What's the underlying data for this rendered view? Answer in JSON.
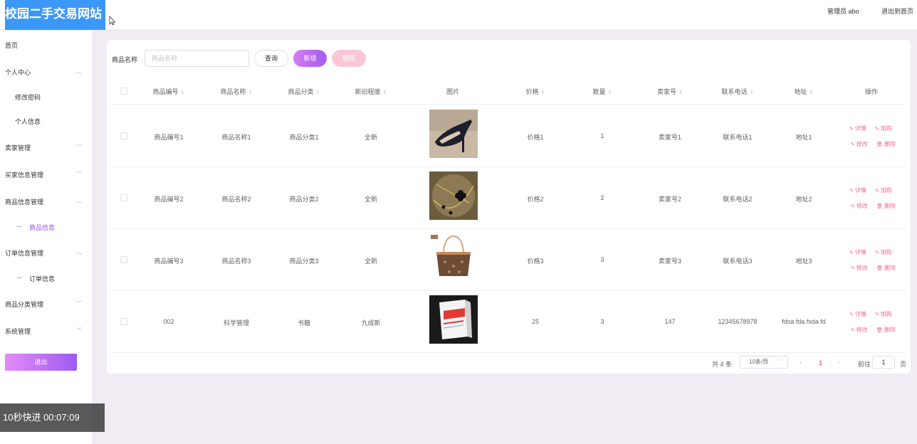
{
  "header": {
    "logo": "校园二手交易网站",
    "admin": "管理员 abo",
    "exit_home": "退出到首页"
  },
  "sidebar": {
    "home": "首页",
    "personal_center": "个人中心",
    "change_password": "修改密码",
    "personal_info": "个人信息",
    "seller_mgmt": "卖家管理",
    "buyer_mgmt": "买家信息管理",
    "product_mgmt": "商品信息管理",
    "product_info": "商品信息",
    "order_mgmt": "订单信息管理",
    "order_info": "订单信息",
    "category_mgmt": "商品分类管理",
    "system_mgmt": "系统管理",
    "logout": "退出"
  },
  "overlay": {
    "timer": "10秒快进   00:07:09"
  },
  "search": {
    "label": "商品名称",
    "placeholder": "商品名称",
    "query": "查询",
    "add": "新增",
    "delete": "删除"
  },
  "table": {
    "columns": [
      "商品编号",
      "商品名称",
      "商品分类",
      "新旧程度",
      "图片",
      "价格",
      "数量",
      "卖家号",
      "联系电话",
      "地址",
      "操作"
    ],
    "rows": [
      {
        "code": "商品编号1",
        "name": "商品名称1",
        "category": "商品分类1",
        "condition": "全新",
        "image": "shoe",
        "price": "价格1",
        "qty": "1",
        "seller": "卖家号1",
        "phone": "联系电话1",
        "address": "地址1"
      },
      {
        "code": "商品编号2",
        "name": "商品名称2",
        "category": "商品分类2",
        "condition": "全新",
        "image": "necklace",
        "price": "价格2",
        "qty": "2",
        "seller": "卖家号2",
        "phone": "联系电话2",
        "address": "地址2"
      },
      {
        "code": "商品编号3",
        "name": "商品名称3",
        "category": "商品分类3",
        "condition": "全新",
        "image": "bag",
        "price": "价格3",
        "qty": "3",
        "seller": "卖家号3",
        "phone": "联系电话3",
        "address": "地址3"
      },
      {
        "code": "002",
        "name": "科学管理",
        "category": "书籍",
        "condition": "九成新",
        "image": "book",
        "price": "25",
        "qty": "3",
        "seller": "147",
        "phone": "12345678978",
        "address": "fdsa fda fsda fd"
      }
    ],
    "actions": {
      "detail": "详情",
      "buy": "加购",
      "edit": "修改",
      "delete": "删除"
    }
  },
  "pagination": {
    "total": "共 4 条",
    "page_size": "10条/页",
    "current": "1",
    "goto_label": "前往",
    "goto_value": "1",
    "page_suffix": "页"
  },
  "colors": {
    "accent": "#9b4de0",
    "logo_bg": "#3c98f8",
    "action": "#f26b8a"
  }
}
